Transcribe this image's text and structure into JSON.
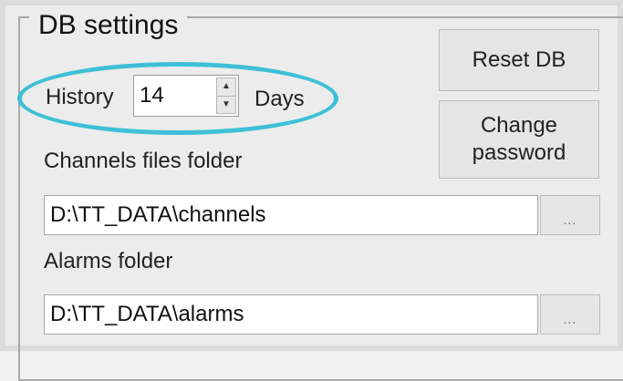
{
  "groupbox": {
    "title": "DB settings"
  },
  "history": {
    "label": "History",
    "value": "14",
    "unit": "Days",
    "up_glyph": "▲",
    "down_glyph": "▼"
  },
  "buttons": {
    "reset_db": "Reset DB",
    "change_password_line1": "Change",
    "change_password_line2": "password"
  },
  "channels": {
    "label": "Channels files folder",
    "path": "D:\\TT_DATA\\channels",
    "browse_label": "..."
  },
  "alarms": {
    "label": "Alarms folder",
    "path": "D:\\TT_DATA\\alarms",
    "browse_label": "..."
  },
  "highlight": {
    "color": "#3ec0d6"
  }
}
